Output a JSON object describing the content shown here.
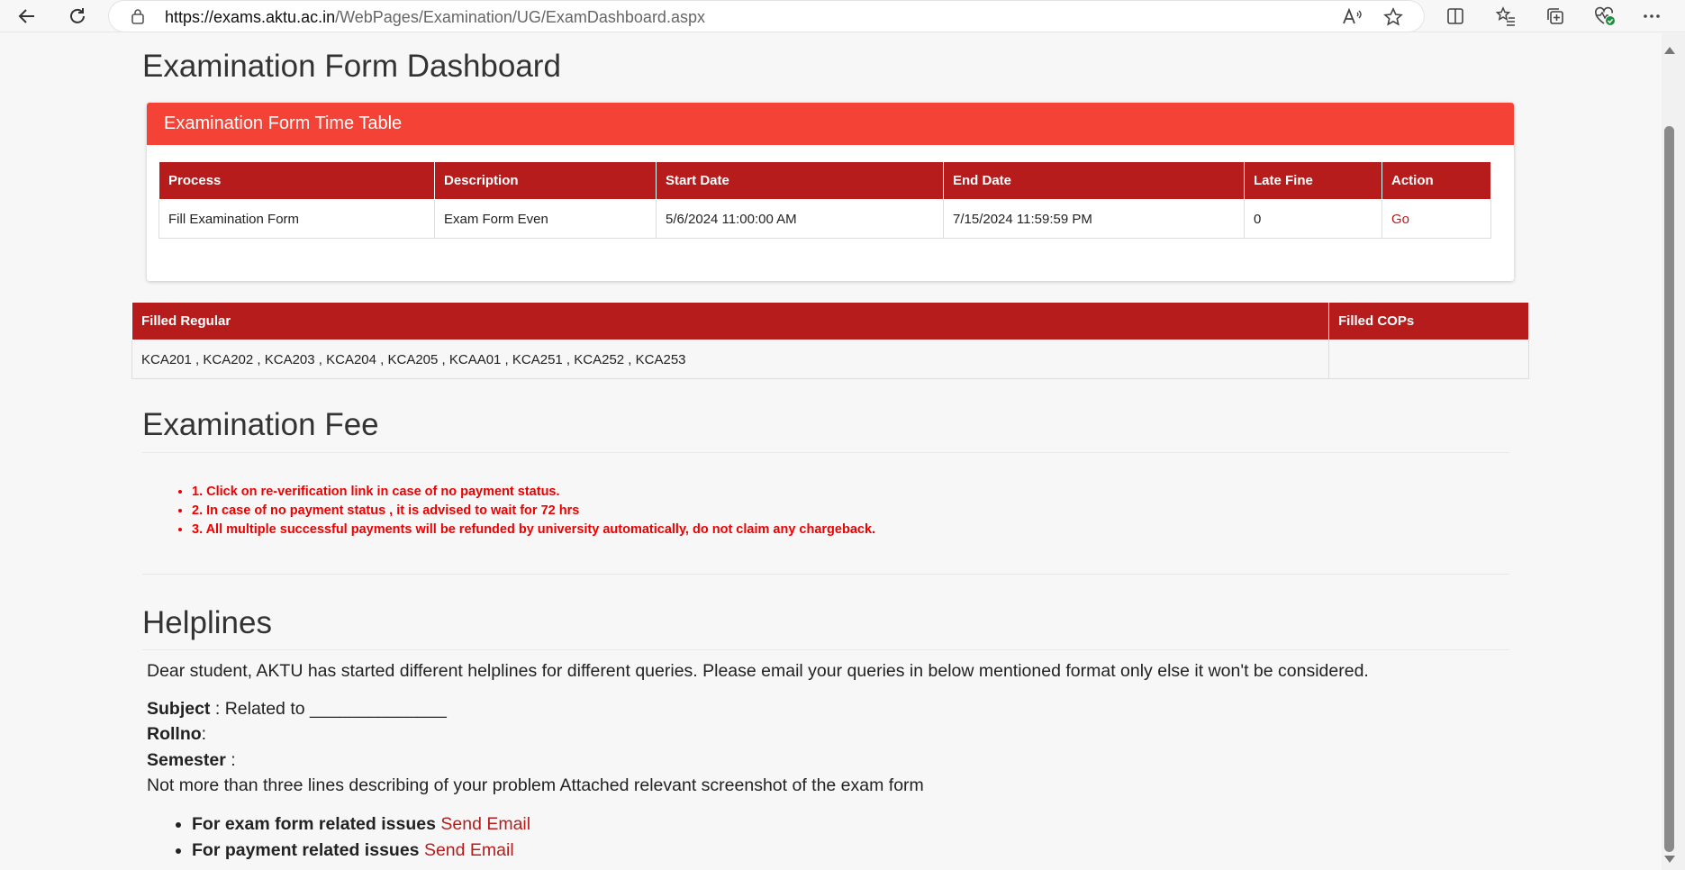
{
  "browser": {
    "url_host": "https://exams.aktu.ac.in",
    "url_path": "/WebPages/Examination/UG/ExamDashboard.aspx",
    "icons": [
      "back-icon",
      "refresh-icon",
      "lock-icon",
      "read-aloud-icon",
      "favorite-star-icon",
      "split-screen-icon",
      "favorites-list-icon",
      "collections-icon",
      "browser-health-icon",
      "more-menu-icon"
    ]
  },
  "page": {
    "title": "Examination Form Dashboard"
  },
  "timetable": {
    "header": "Examination Form Time Table",
    "columns": [
      "Process",
      "Description",
      "Start Date",
      "End Date",
      "Late Fine",
      "Action"
    ],
    "rows": [
      {
        "process": "Fill Examination Form",
        "description": "Exam Form Even",
        "start": "5/6/2024 11:00:00 AM",
        "end": "7/15/2024 11:59:59 PM",
        "late_fine": "0",
        "action": "Go"
      }
    ]
  },
  "filled": {
    "columns": [
      "Filled Regular",
      "Filled COPs"
    ],
    "regular": "KCA201 , KCA202 , KCA203 , KCA204 , KCA205 , KCAA01 , KCA251 , KCA252 , KCA253",
    "cops": ""
  },
  "fee": {
    "title": "Examination Fee",
    "notes": [
      "1. Click on re-verification link in case of no payment status.",
      "2. In case of no payment status , it is advised to wait for 72 hrs",
      "3. All multiple successful payments will be refunded by university automatically, do not claim any chargeback."
    ]
  },
  "helplines": {
    "title": "Helplines",
    "intro": "Dear student, AKTU has started different helplines for different queries. Please email your queries in below mentioned format only else it won't be considered.",
    "subject_label": "Subject",
    "subject_value": " : Related to ______________",
    "rollno_label": "Rollno",
    "rollno_value": ":",
    "semester_label": "Semester",
    "semester_value": " :",
    "description": "Not more than three lines describing of your problem Attached relevant screenshot of the exam form",
    "links": [
      {
        "label": "For exam form related issues",
        "link": "Send Email"
      },
      {
        "label": "For payment related issues",
        "link": "Send Email"
      }
    ]
  },
  "colors": {
    "accent": "#f44336",
    "table_header": "#b71c1c",
    "warning_text": "#ee0000",
    "link": "#b71c1c"
  }
}
